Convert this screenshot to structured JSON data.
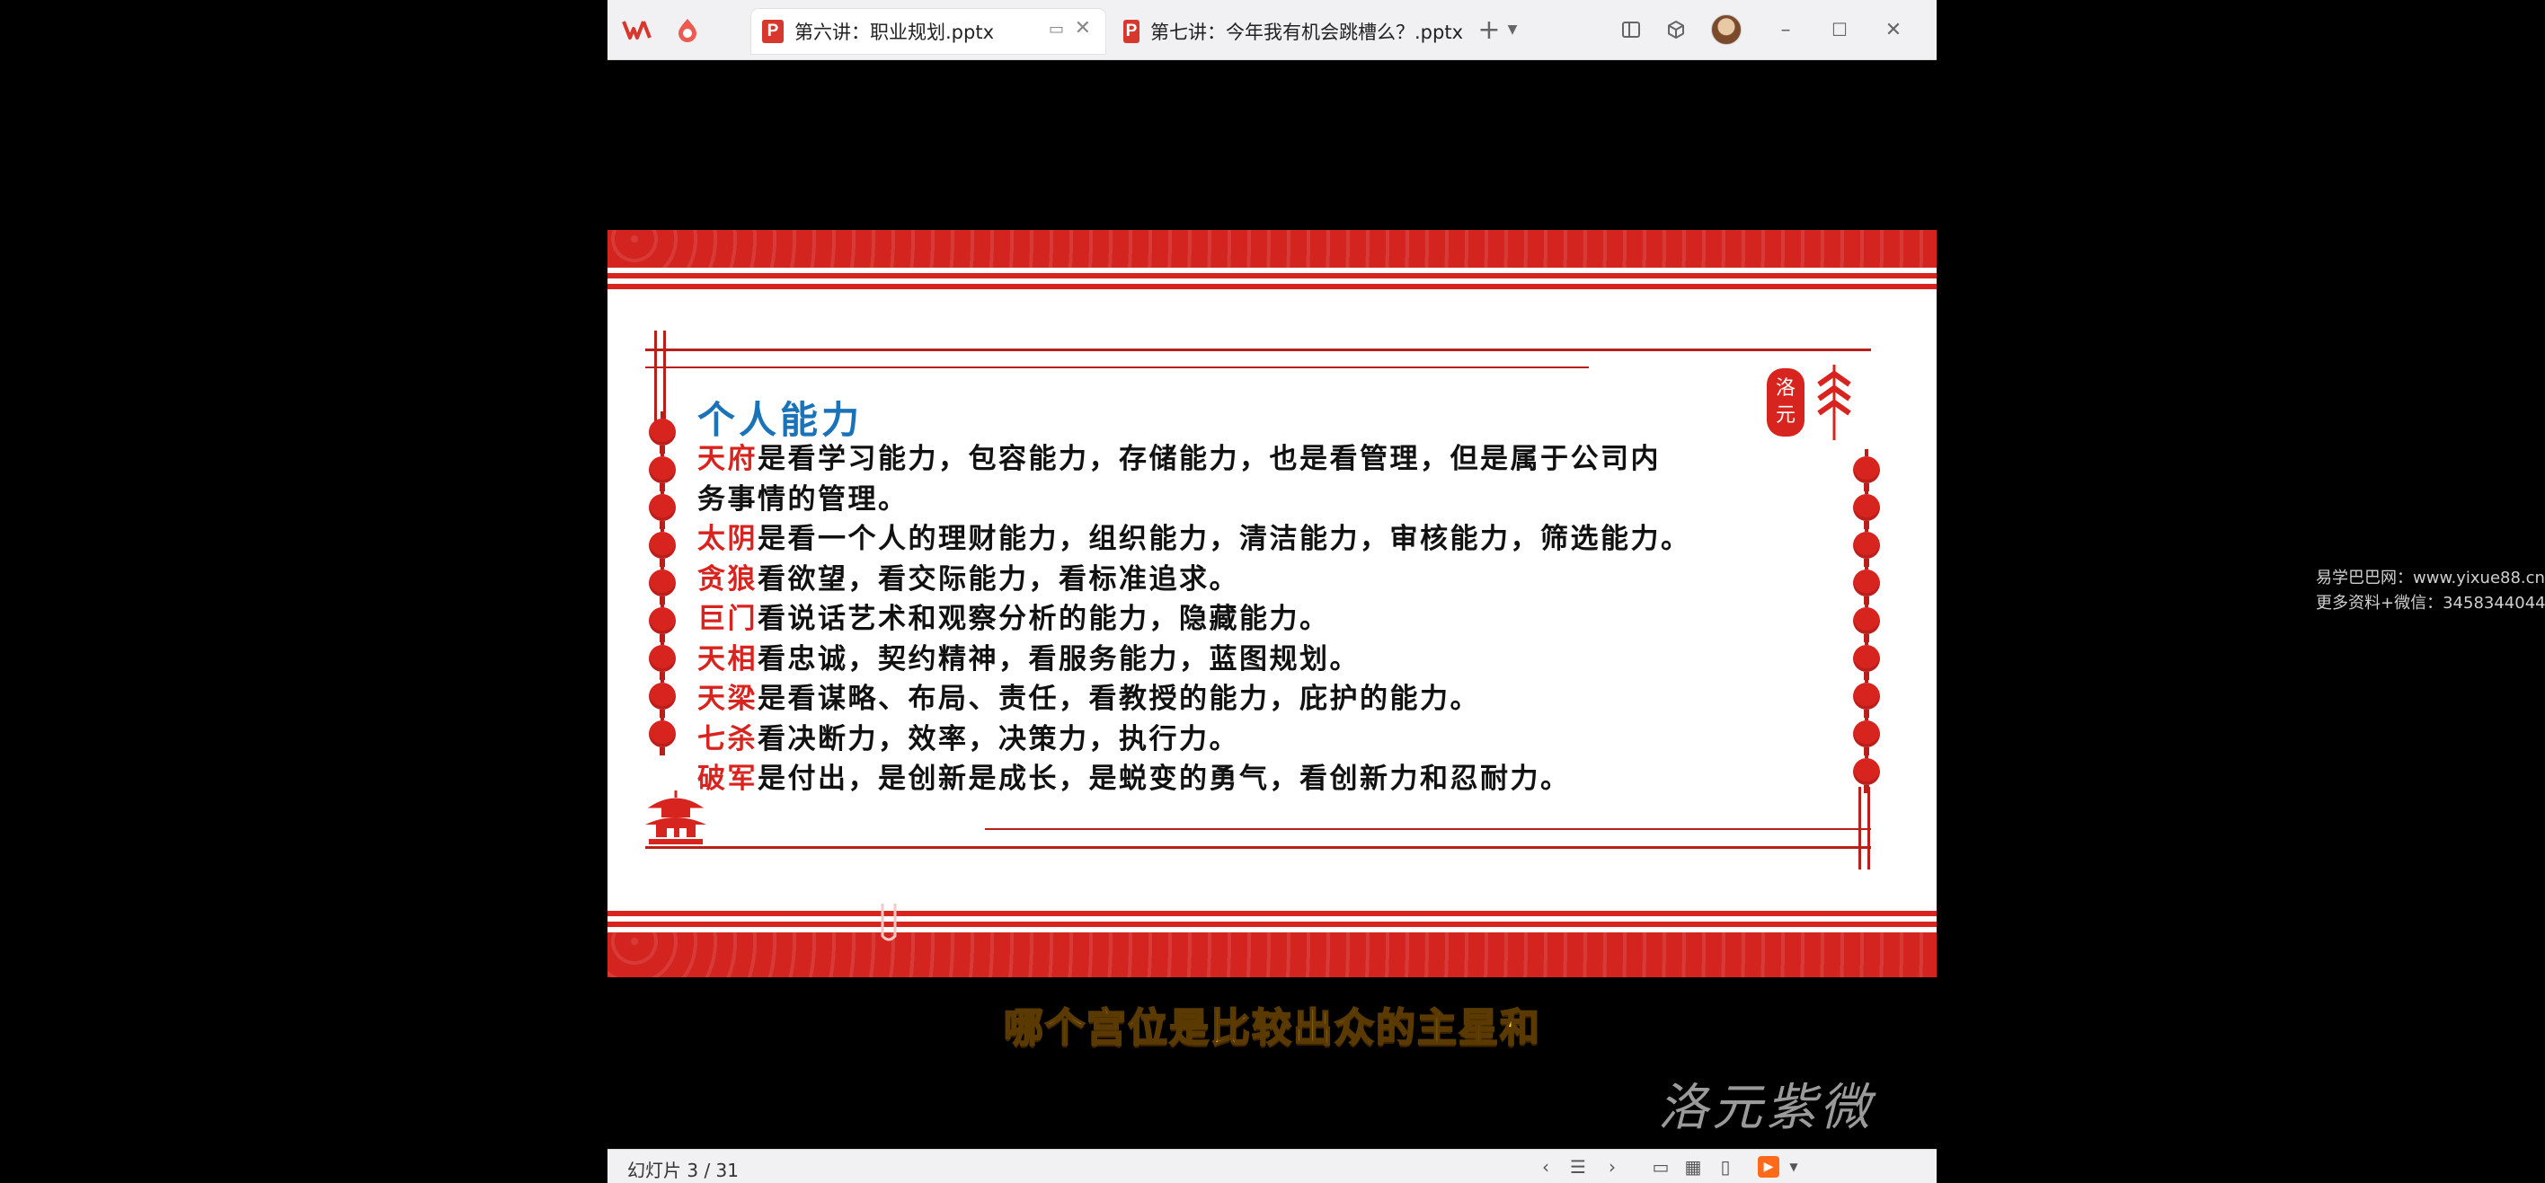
{
  "tabs": [
    {
      "label": "第六讲：职业规划.pptx",
      "active": true
    },
    {
      "label": "第七讲：今年我有机会跳槽么？.pptx",
      "active": false
    }
  ],
  "slide": {
    "title": "个人能力",
    "seal_text": "洛元",
    "lines": [
      {
        "star": "天府",
        "text": "是看学习能力，包容能力，存储能力，也是看管理，但是属于公司内"
      },
      {
        "star": "",
        "text": "务事情的管理。"
      },
      {
        "star": "太阴",
        "text": "是看一个人的理财能力，组织能力，清洁能力，审核能力，筛选能力。"
      },
      {
        "star": "贪狼",
        "text": "看欲望，看交际能力，看标准追求。"
      },
      {
        "star": "巨门",
        "text": "看说话艺术和观察分析的能力，隐藏能力。"
      },
      {
        "star": "天相",
        "text": "看忠诚，契约精神，看服务能力，蓝图规划。"
      },
      {
        "star": "天梁",
        "text": "是看谋略、布局、责任，看教授的能力，庇护的能力。"
      },
      {
        "star": "七杀",
        "text": "看决断力，效率，决策力，执行力。"
      },
      {
        "star": "破军",
        "text": "是付出，是创新是成长，是蜕变的勇气，看创新力和忍耐力。"
      }
    ]
  },
  "video": {
    "subtitle": "哪个宫位是比较出众的主星和",
    "signature": "洛元紫微"
  },
  "status": {
    "slide_counter": "幻灯片 3 / 31"
  },
  "watermark": {
    "line1": "易学巴巴网：www.yixue88.cn",
    "line2": "更多资料+微信：3458344044"
  },
  "colors": {
    "accent_red": "#d7241f",
    "title_blue": "#1a72b8",
    "subtitle_yellow": "#ffe14a"
  }
}
